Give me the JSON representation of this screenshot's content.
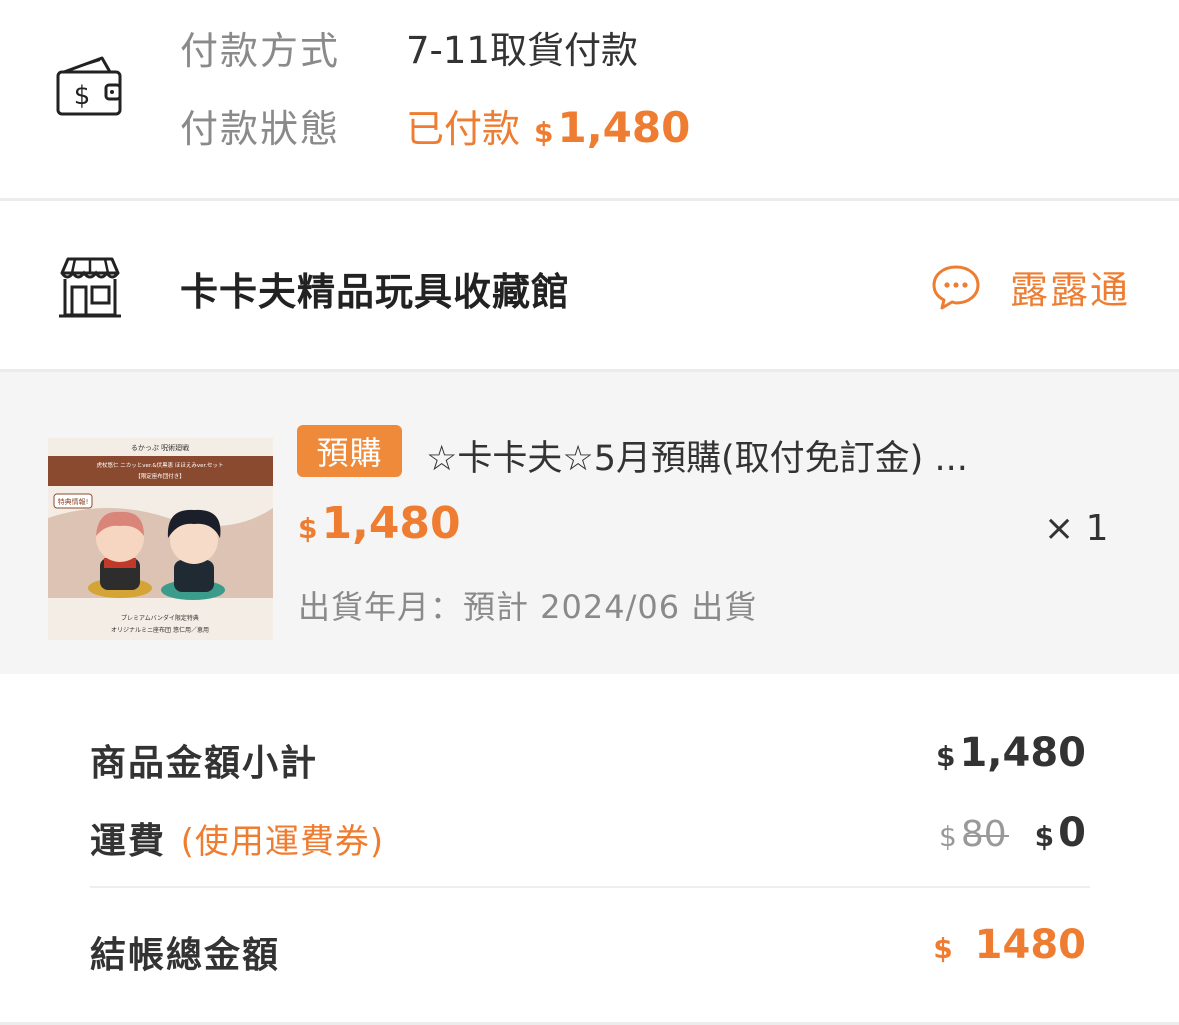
{
  "payment": {
    "method_label": "付款方式",
    "method_value": "7-11取貨付款",
    "status_label": "付款狀態",
    "status_text": "已付款",
    "status_currency": "$",
    "status_amount": "1,480",
    "icon": "wallet-icon"
  },
  "store": {
    "name": "卡卡夫精品玩具收藏館",
    "chat_label": "露露通",
    "icon": "store-icon",
    "chat_icon": "chat-bubble-icon"
  },
  "product": {
    "badge": "預購",
    "title": "☆卡卡夫☆5月預購(取付免訂金) ...",
    "currency": "$",
    "price": "1,480",
    "quantity": "× 1",
    "shipping": "出貨年月：預計 2024/06 出貨",
    "thumb_text": {
      "brand": "るかっぷ 呪術廻戦",
      "line1": "虎杖悠仁 ニカッとver.&伏黒恵 ほほえみver.セット",
      "line2": "【限定座布団付き】",
      "bonus": "特典情報!",
      "footer1": "プレミアムバンダイ限定特典",
      "footer2": "オリジナルミニ座布団 悠仁用／恵用"
    }
  },
  "summary": {
    "subtotal_label": "商品金額小計",
    "subtotal_currency": "$",
    "subtotal_amount": "1,480",
    "shipping_label": "運費",
    "shipping_note": "(使用運費券)",
    "shipping_orig_currency": "$",
    "shipping_orig_amount": "80",
    "shipping_currency": "$",
    "shipping_amount": "0",
    "total_label": "結帳總金額",
    "total_currency": "$",
    "total_amount": "1480"
  },
  "colors": {
    "accent": "#ee7d31",
    "badge": "#ee8a3a",
    "muted_text": "#8a8a8a",
    "product_bg": "#f5f5f5"
  }
}
